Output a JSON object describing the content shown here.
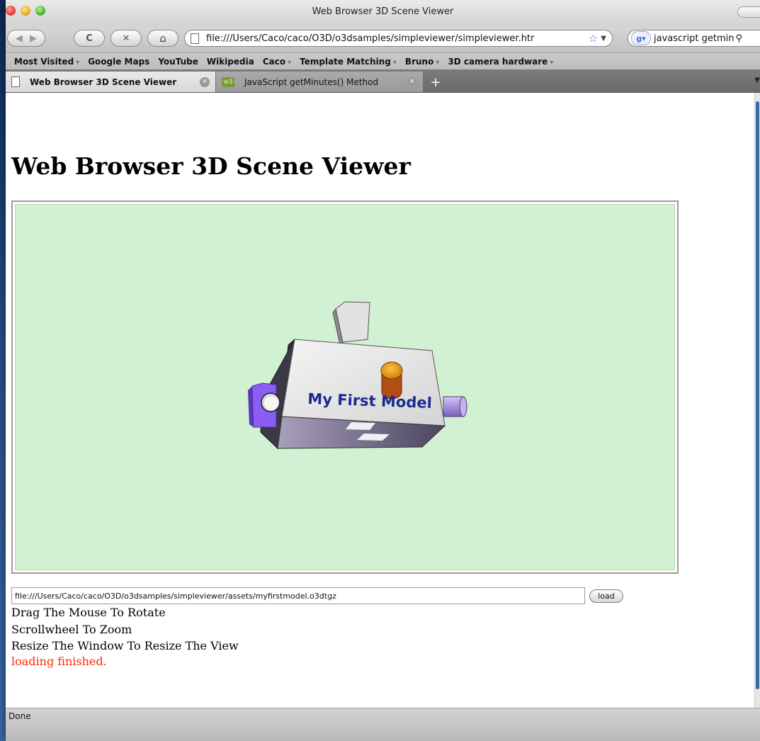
{
  "window": {
    "title": "Web Browser 3D Scene Viewer"
  },
  "toolbar": {
    "back_icon": "◀",
    "forward_icon": "▶",
    "reload_icon": "C",
    "stop_icon": "✕",
    "home_icon": "⌂",
    "url": "file:///Users/Caco/caco/O3D/o3dsamples/simpleviewer/simpleviewer.htr",
    "search_value": "javascript getmin"
  },
  "bookmarks": [
    {
      "label": "Most Visited",
      "has_menu": true
    },
    {
      "label": "Google Maps",
      "has_menu": false
    },
    {
      "label": "YouTube",
      "has_menu": false
    },
    {
      "label": "Wikipedia",
      "has_menu": false
    },
    {
      "label": "Caco",
      "has_menu": true
    },
    {
      "label": "Template Matching",
      "has_menu": true
    },
    {
      "label": "Bruno",
      "has_menu": true
    },
    {
      "label": "3D camera hardware",
      "has_menu": true
    }
  ],
  "tabs": [
    {
      "label": "Web Browser 3D Scene Viewer",
      "active": true
    },
    {
      "label": "JavaScript getMinutes() Method",
      "active": false
    }
  ],
  "new_tab_label": "+",
  "page": {
    "heading": "Web Browser 3D Scene Viewer",
    "model_label": "My First Model",
    "file_path": "file:///Users/Caco/caco/O3D/o3dsamples/simpleviewer/assets/myfirstmodel.o3dtgz",
    "load_button": "load",
    "instructions": [
      "Drag The Mouse To Rotate",
      "Scrollwheel To Zoom",
      "Resize The Window To Resize The View"
    ],
    "status": "loading finished."
  },
  "statusbar": {
    "text": "Done"
  },
  "colors": {
    "viewer_background": "#d2f0d2",
    "status_text": "#ff2a00",
    "model_label": "#1c2a8f",
    "knob": "#e69a1a",
    "side_block": "#8a5ef2",
    "cylinder": "#b69ae6"
  }
}
